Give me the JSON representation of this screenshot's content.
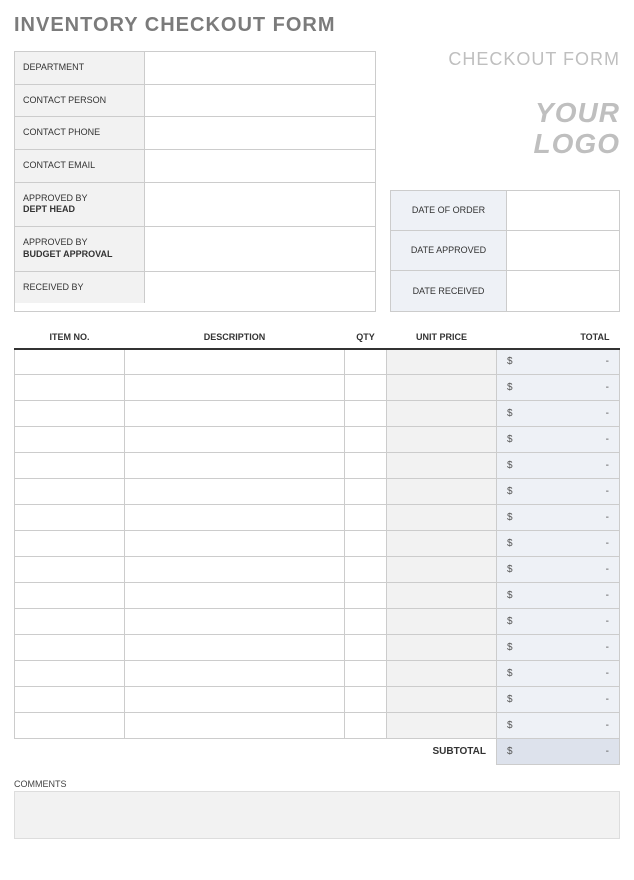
{
  "title": "INVENTORY CHECKOUT FORM",
  "header": {
    "checkout": "CHECKOUT FORM",
    "logo_line1": "YOUR",
    "logo_line2": "LOGO"
  },
  "info": {
    "department_label": "DEPARTMENT",
    "department_value": "",
    "contact_person_label": "CONTACT PERSON",
    "contact_person_value": "",
    "contact_phone_label": "CONTACT PHONE",
    "contact_phone_value": "",
    "contact_email_label": "CONTACT EMAIL",
    "contact_email_value": "",
    "approved_by_label": "APPROVED BY",
    "dept_head_sub": "DEPT HEAD",
    "dept_head_value": "",
    "budget_approval_sub": "BUDGET APPROVAL",
    "budget_approval_value": "",
    "received_by_label": "RECEIVED BY",
    "received_by_value": ""
  },
  "dates": {
    "order_label": "DATE OF ORDER",
    "order_value": "",
    "approved_label": "DATE APPROVED",
    "approved_value": "",
    "received_label": "DATE RECEIVED",
    "received_value": ""
  },
  "columns": {
    "item_no": "ITEM NO.",
    "description": "DESCRIPTION",
    "qty": "QTY",
    "unit_price": "UNIT PRICE",
    "total": "TOTAL"
  },
  "rows": [
    {
      "item_no": "",
      "description": "",
      "qty": "",
      "unit_price": "",
      "total_symbol": "$",
      "total_value": "-"
    },
    {
      "item_no": "",
      "description": "",
      "qty": "",
      "unit_price": "",
      "total_symbol": "$",
      "total_value": "-"
    },
    {
      "item_no": "",
      "description": "",
      "qty": "",
      "unit_price": "",
      "total_symbol": "$",
      "total_value": "-"
    },
    {
      "item_no": "",
      "description": "",
      "qty": "",
      "unit_price": "",
      "total_symbol": "$",
      "total_value": "-"
    },
    {
      "item_no": "",
      "description": "",
      "qty": "",
      "unit_price": "",
      "total_symbol": "$",
      "total_value": "-"
    },
    {
      "item_no": "",
      "description": "",
      "qty": "",
      "unit_price": "",
      "total_symbol": "$",
      "total_value": "-"
    },
    {
      "item_no": "",
      "description": "",
      "qty": "",
      "unit_price": "",
      "total_symbol": "$",
      "total_value": "-"
    },
    {
      "item_no": "",
      "description": "",
      "qty": "",
      "unit_price": "",
      "total_symbol": "$",
      "total_value": "-"
    },
    {
      "item_no": "",
      "description": "",
      "qty": "",
      "unit_price": "",
      "total_symbol": "$",
      "total_value": "-"
    },
    {
      "item_no": "",
      "description": "",
      "qty": "",
      "unit_price": "",
      "total_symbol": "$",
      "total_value": "-"
    },
    {
      "item_no": "",
      "description": "",
      "qty": "",
      "unit_price": "",
      "total_symbol": "$",
      "total_value": "-"
    },
    {
      "item_no": "",
      "description": "",
      "qty": "",
      "unit_price": "",
      "total_symbol": "$",
      "total_value": "-"
    },
    {
      "item_no": "",
      "description": "",
      "qty": "",
      "unit_price": "",
      "total_symbol": "$",
      "total_value": "-"
    },
    {
      "item_no": "",
      "description": "",
      "qty": "",
      "unit_price": "",
      "total_symbol": "$",
      "total_value": "-"
    },
    {
      "item_no": "",
      "description": "",
      "qty": "",
      "unit_price": "",
      "total_symbol": "$",
      "total_value": "-"
    }
  ],
  "subtotal": {
    "label": "SUBTOTAL",
    "symbol": "$",
    "value": "-"
  },
  "comments": {
    "label": "COMMENTS",
    "value": ""
  }
}
